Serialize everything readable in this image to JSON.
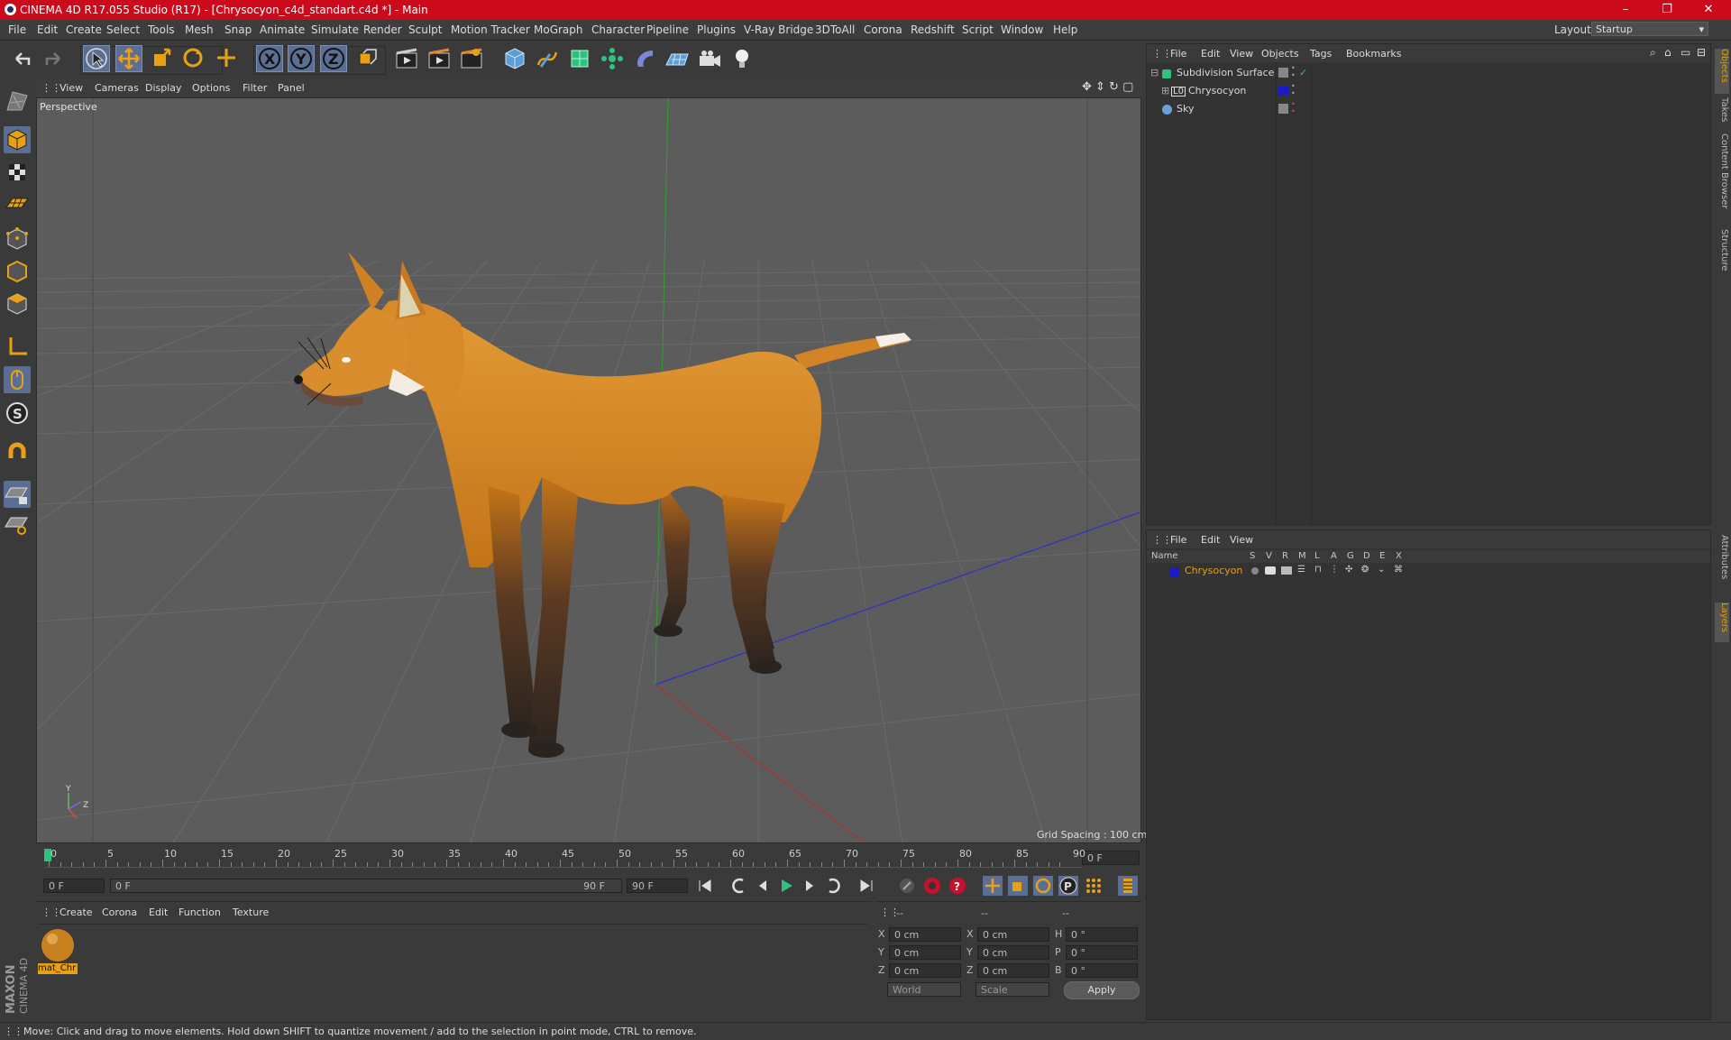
{
  "window": {
    "title": "CINEMA 4D R17.055 Studio (R17) - [Chrysocyon_c4d_standart.c4d *] - Main",
    "controls": [
      "–",
      "❐",
      "✕"
    ]
  },
  "menubar": {
    "items": [
      "File",
      "Edit",
      "Create",
      "Select",
      "Tools",
      "Mesh",
      "Snap",
      "Animate",
      "Simulate",
      "Render",
      "Sculpt",
      "Motion Tracker",
      "MoGraph",
      "Character",
      "Pipeline",
      "Plugins",
      "V-Ray Bridge",
      "3DToAll",
      "Corona",
      "Redshift",
      "Script",
      "Window",
      "Help"
    ],
    "layout_label": "Layout:",
    "layout_value": "Startup"
  },
  "viewport": {
    "menu": [
      "View",
      "Cameras",
      "Display",
      "Options",
      "Filter",
      "Panel"
    ],
    "label": "Perspective",
    "grid_spacing": "Grid Spacing : 100 cm",
    "axis_labels": {
      "y": "Y",
      "z": "Z"
    }
  },
  "timeline": {
    "ticks": [
      "0",
      "5",
      "10",
      "15",
      "20",
      "25",
      "30",
      "35",
      "40",
      "45",
      "50",
      "55",
      "60",
      "65",
      "70",
      "75",
      "80",
      "85",
      "90"
    ],
    "current_frame": "0 F",
    "start_field": "0 F",
    "slider_left": "0 F",
    "slider_right": "90 F",
    "end_field": "90 F"
  },
  "materials": {
    "menu": [
      "Create",
      "Corona",
      "Edit",
      "Function",
      "Texture"
    ],
    "items": [
      {
        "name": "mat_Chr"
      }
    ]
  },
  "coordinates": {
    "header": [
      "--",
      "--",
      "--"
    ],
    "rows": [
      {
        "a": "X",
        "v1": "0 cm",
        "b": "X",
        "v2": "0 cm",
        "c": "H",
        "v3": "0 °"
      },
      {
        "a": "Y",
        "v1": "0 cm",
        "b": "Y",
        "v2": "0 cm",
        "c": "P",
        "v3": "0 °"
      },
      {
        "a": "Z",
        "v1": "0 cm",
        "b": "Z",
        "v2": "0 cm",
        "c": "B",
        "v3": "0 °"
      }
    ],
    "mode1": "World",
    "mode2": "Scale",
    "apply": "Apply"
  },
  "objects_panel": {
    "menu": [
      "File",
      "Edit",
      "View",
      "Objects",
      "Tags",
      "Bookmarks"
    ],
    "items": [
      {
        "name": "Subdivision Surface",
        "color": "#2ec27e"
      },
      {
        "name": "Chrysocyon",
        "color": "#cccccc"
      },
      {
        "name": "Sky",
        "color": "#6aa0d8"
      }
    ]
  },
  "layers_panel": {
    "menu": [
      "File",
      "Edit",
      "View"
    ],
    "columns": [
      "Name",
      "S",
      "V",
      "R",
      "M",
      "L",
      "A",
      "G",
      "D",
      "E",
      "X"
    ],
    "items": [
      {
        "name": "Chrysocyon",
        "color": "#1a1acc"
      }
    ]
  },
  "side_tabs": [
    "Objects",
    "Takes",
    "Content Browser",
    "Structure",
    "Attributes",
    "Layers"
  ],
  "status": "Move: Click and drag to move elements. Hold down SHIFT to quantize movement / add to the selection in point mode, CTRL to remove.",
  "brand": [
    "MAXON",
    "CINEMA 4D"
  ],
  "colors": {
    "titlebar": "#cc0a1c",
    "accent": "#5a6f93",
    "fox": "#d9892b"
  }
}
